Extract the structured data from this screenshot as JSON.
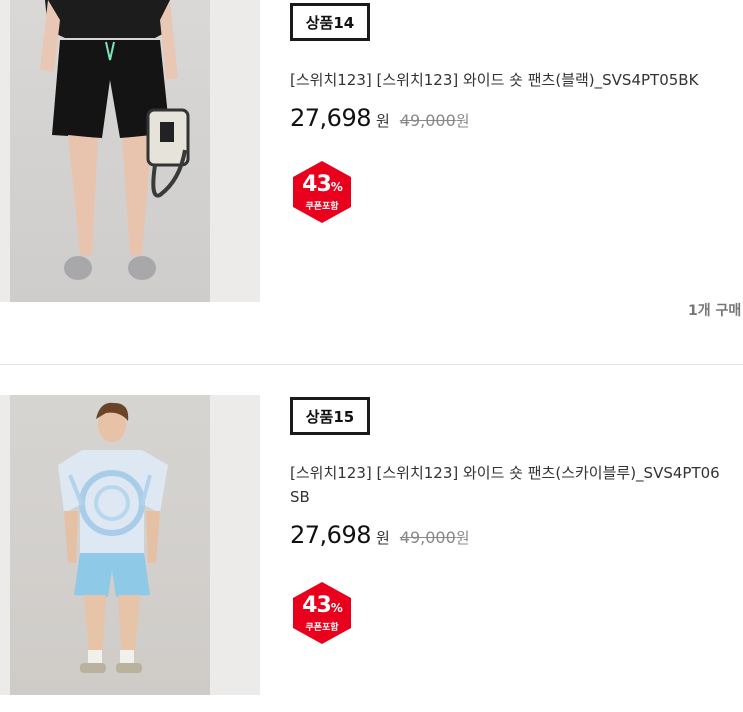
{
  "products": [
    {
      "label": "상품14",
      "name": "[스위치123] [스위치123] 와이드 숏 팬츠(블랙)_SVS4PT05BK",
      "price": "27,698",
      "currency": "원",
      "original_price": "49,000",
      "original_currency": "원",
      "discount": "43",
      "discount_unit": "%",
      "coupon_text": "쿠폰포함",
      "purchase_count": "1개 구매"
    },
    {
      "label": "상품15",
      "name": "[스위치123] [스위치123] 와이드 숏 팬츠(스카이블루)_SVS4PT06SB",
      "price": "27,698",
      "currency": "원",
      "original_price": "49,000",
      "original_currency": "원",
      "discount": "43",
      "discount_unit": "%",
      "coupon_text": "쿠폰포함"
    }
  ],
  "colors": {
    "badge": "#e8001c",
    "label_border": "#1a1a1a",
    "divider": "#e4e4e4"
  }
}
